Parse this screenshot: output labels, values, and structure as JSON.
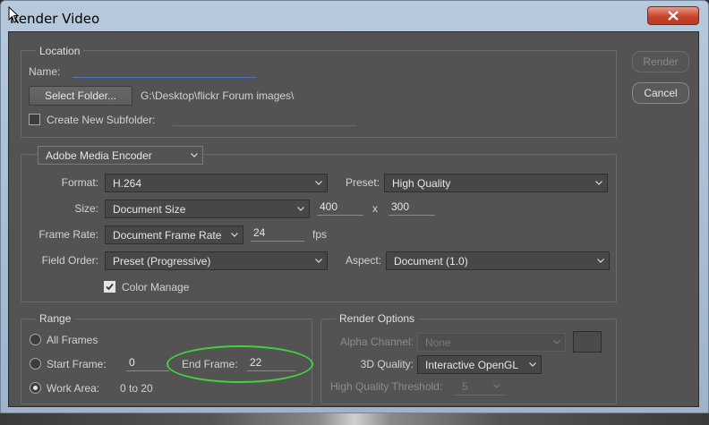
{
  "window": {
    "title": "Render Video"
  },
  "buttons": {
    "render": "Render",
    "cancel": "Cancel"
  },
  "location": {
    "group_label": "Location",
    "name_label": "Name:",
    "name_value": "",
    "select_folder": "Select Folder...",
    "folder_path": "G:\\Desktop\\flickr  Forum images\\",
    "create_subfolder_label": "Create New Subfolder:",
    "create_subfolder_checked": false,
    "subfolder_value": ""
  },
  "encoder": {
    "selected": "Adobe Media Encoder",
    "format_label": "Format:",
    "format_value": "H.264",
    "preset_label": "Preset:",
    "preset_value": "High Quality",
    "size_label": "Size:",
    "size_value": "Document Size",
    "width": "400",
    "x_sep": "x",
    "height": "300",
    "frame_rate_label": "Frame Rate:",
    "frame_rate_value": "Document Frame Rate",
    "fps_value": "24",
    "fps_label": "fps",
    "field_order_label": "Field Order:",
    "field_order_value": "Preset (Progressive)",
    "aspect_label": "Aspect:",
    "aspect_value": "Document (1.0)",
    "color_manage_label": "Color Manage",
    "color_manage_checked": true
  },
  "range": {
    "group_label": "Range",
    "all_frames": "All Frames",
    "start_frame_label": "Start Frame:",
    "start_frame_value": "0",
    "end_frame_label": "End Frame:",
    "end_frame_value": "22",
    "work_area_label": "Work Area:",
    "work_area_value": "0 to 20",
    "selected": "work_area"
  },
  "render_options": {
    "group_label": "Render Options",
    "alpha_channel_label": "Alpha Channel:",
    "alpha_channel_value": "None",
    "quality_3d_label": "3D Quality:",
    "quality_3d_value": "Interactive OpenGL",
    "hq_threshold_label": "High Quality Threshold:",
    "hq_threshold_value": "5"
  },
  "colors": {
    "highlight_ellipse": "#3fd23f",
    "close_button": "#c8432c"
  }
}
